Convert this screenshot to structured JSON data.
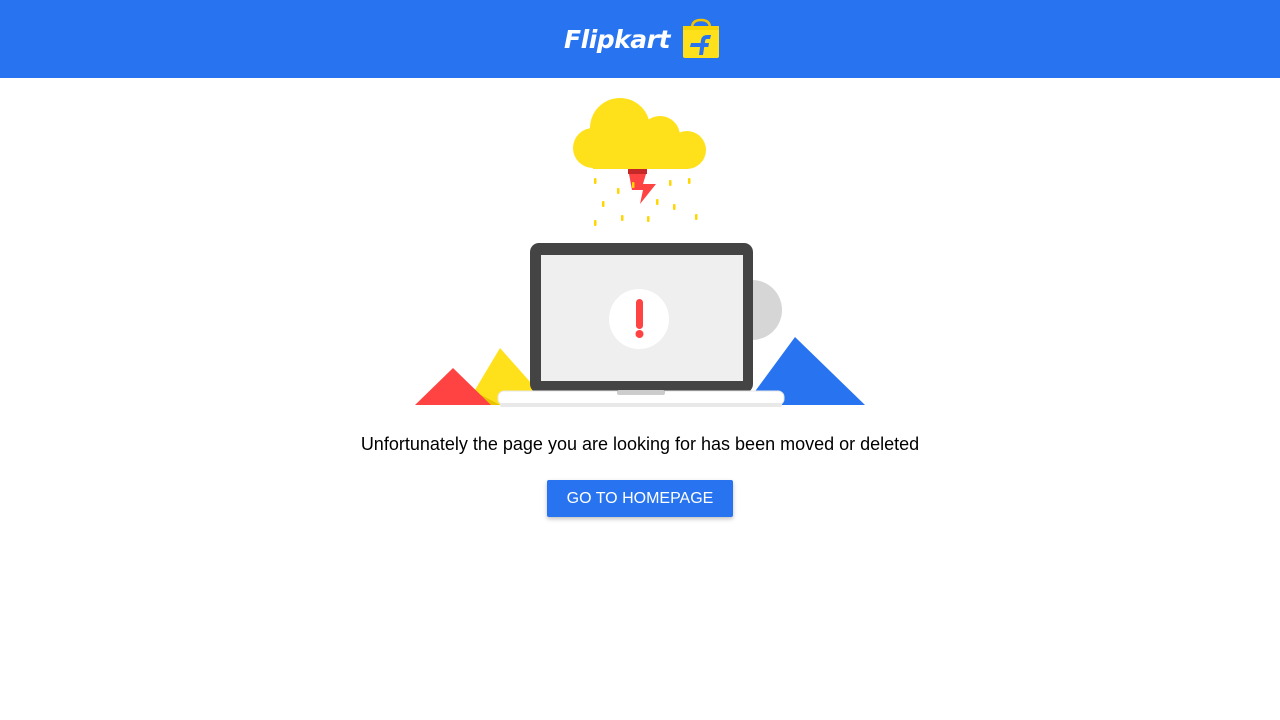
{
  "header": {
    "brand_name": "Flipkart",
    "background_color": "#2874f0",
    "logo_icon": "shopping-bag-icon"
  },
  "error": {
    "illustration": "cloud-lightning-laptop-error-illustration",
    "message": "Unfortunately the page you are looking for has been moved or deleted",
    "button_label": "GO TO HOMEPAGE"
  },
  "colors": {
    "accent": "#2874f0",
    "yellow": "#ffe11b",
    "red": "#ff4343"
  }
}
